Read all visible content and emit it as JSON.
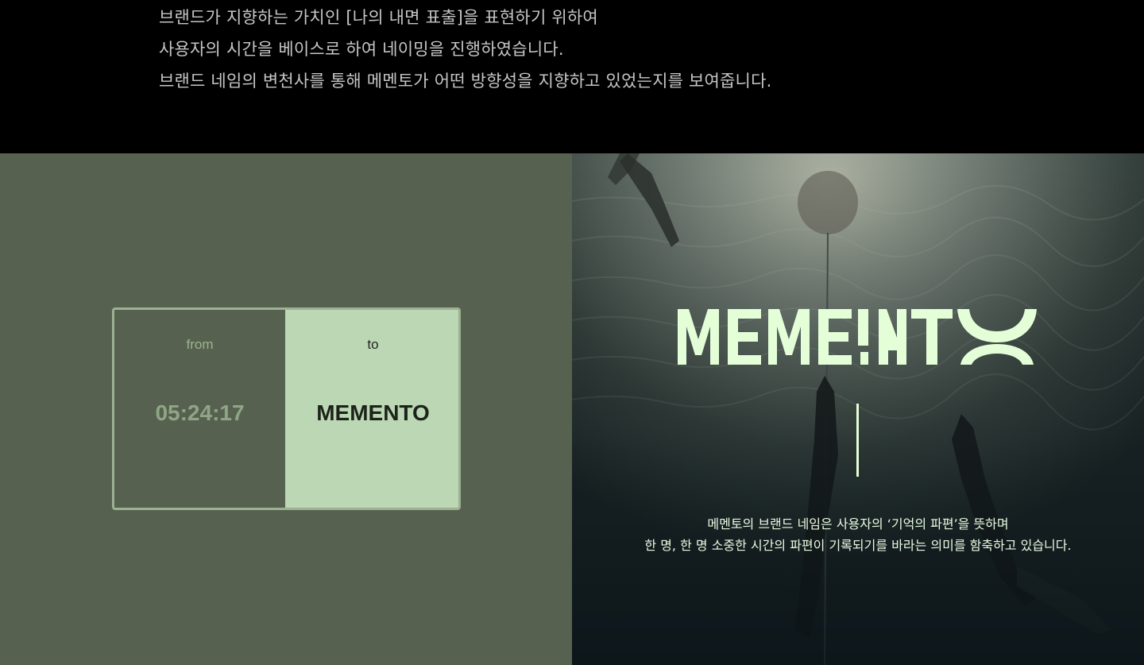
{
  "intro": {
    "lines": [
      "브랜드가 지향하는 가치인 [나의 내면 표출]을 표현하기 위하여",
      "사용자의 시간을 베이스로 하여 네이밍을 진행하였습니다.",
      "브랜드 네임의 변천사를 통해 메멘토가 어떤 방향성을 지향하고 있었는지를 보여줍니다."
    ]
  },
  "naming_card": {
    "from_label": "from",
    "from_value": "05:24:17",
    "to_label": "to",
    "to_value": "MEMENTO"
  },
  "brand": {
    "logo_text": "MEMENTO",
    "description": [
      "메멘토의 브랜드 네임은 사용자의 ‘기억의 파편’을 뜻하며",
      "한 명, 한 명 소중한 시간의 파편이 기록되기를 바라는 의미를 함축하고 있습니다."
    ]
  },
  "colors": {
    "background_top": "#000000",
    "left_panel": "#56624f",
    "card_to": "#bbd7b4",
    "card_border": "#9cb293",
    "logo": "#e4ffd8"
  }
}
